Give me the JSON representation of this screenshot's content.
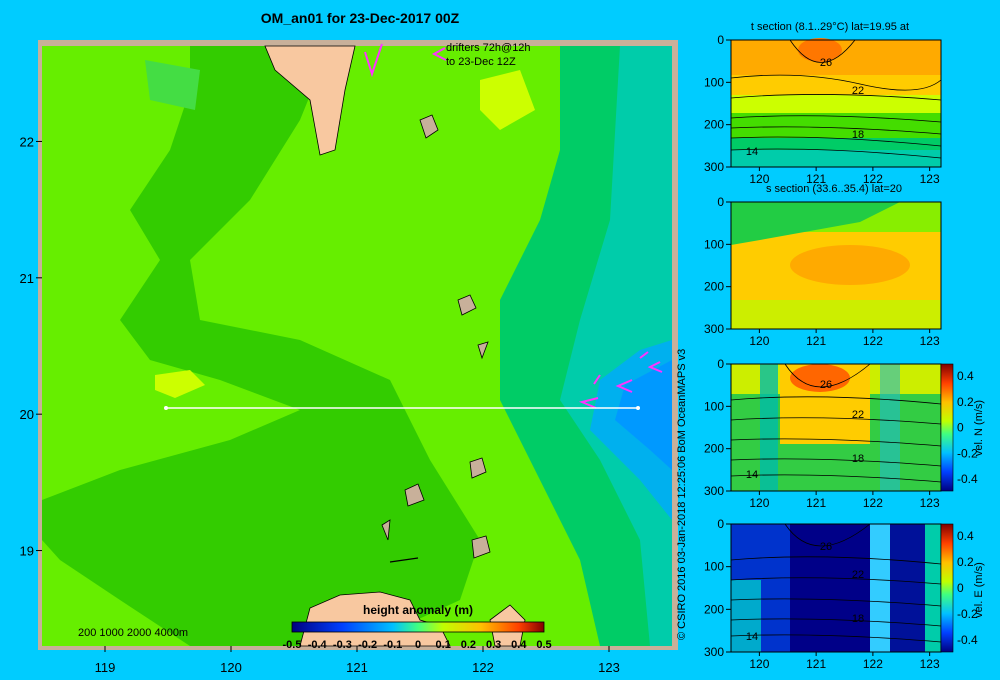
{
  "main_map": {
    "title": "OM_an01 for 23-Dec-2017 00Z",
    "drifters_line1": "drifters 72h@12h",
    "drifters_line2": "to 23-Dec 12Z",
    "depth_scale": "200 1000 2000 4000m",
    "colorbar_title": "height anomaly (m)",
    "colorbar_ticks": [
      "-0.5",
      "-0.4",
      "-0.3",
      "-0.2",
      "-0.1",
      "0",
      "0.1",
      "0.2",
      "0.3",
      "0.4",
      "0.5"
    ],
    "x_ticks": [
      "119",
      "120",
      "121",
      "122",
      "123"
    ],
    "y_ticks": [
      "22",
      "21",
      "20",
      "19"
    ],
    "section_line": {
      "lon_start": 119.5,
      "lon_end": 123.2,
      "lat": 20
    }
  },
  "panels": {
    "t_title": "t section (8.1..29°C) lat=19.95 at",
    "s_title": "s section (33.6..35.4) lat=20",
    "vn_cbar_label": "vel. N (m/s)",
    "ve_cbar_label": "vel. E (m/s)",
    "y_ticks": [
      "0",
      "100",
      "200",
      "300"
    ],
    "x_ticks": [
      "120",
      "121",
      "122",
      "123"
    ],
    "cbar_ticks": [
      "0.4",
      "0.2",
      "0",
      "-0.2",
      "-0.4"
    ],
    "t_contour_labels": [
      "26",
      "22",
      "18",
      "14"
    ],
    "vn_contour_labels": [
      "26",
      "22",
      "18",
      "14"
    ],
    "ve_contour_labels": [
      "26",
      "22",
      "18",
      "14"
    ]
  },
  "credit": "© CSIRO 2016   03-Jan-2018 12:25:06 BoM OceanMAPS v3",
  "colors": {
    "background": "#00ccff",
    "land": "#f8c8a0",
    "shelf": "#c8b09a",
    "drifter": "#ff33ff"
  },
  "chart_data": [
    {
      "type": "heatmap",
      "title": "OM_an01 for 23-Dec-2017 00Z",
      "xlabel": "",
      "ylabel": "",
      "xlim": [
        118.5,
        123.5
      ],
      "ylim": [
        18.3,
        22.7
      ],
      "colorbar": {
        "label": "height anomaly (m)",
        "range": [
          -0.5,
          0.5
        ]
      },
      "description_values": {
        "western_basin": 0.05,
        "eastern_low_near_123E_20N": -0.25
      }
    },
    {
      "type": "heatmap",
      "title": "t section (8.1..29°C) lat=19.95 at",
      "xlim": [
        119.5,
        123.2
      ],
      "ylim": [
        300,
        0
      ],
      "contours": [
        26,
        22,
        18,
        14
      ]
    },
    {
      "type": "heatmap",
      "title": "s section (33.6..35.4) lat=20",
      "xlim": [
        119.5,
        123.2
      ],
      "ylim": [
        300,
        0
      ]
    },
    {
      "type": "heatmap",
      "title": "vel. N (m/s)",
      "xlim": [
        119.5,
        123.2
      ],
      "ylim": [
        300,
        0
      ],
      "colorbar": {
        "range": [
          -0.4,
          0.4
        ]
      }
    },
    {
      "type": "heatmap",
      "title": "vel. E (m/s)",
      "xlim": [
        119.5,
        123.2
      ],
      "ylim": [
        300,
        0
      ],
      "colorbar": {
        "range": [
          -0.4,
          0.4
        ]
      }
    }
  ]
}
